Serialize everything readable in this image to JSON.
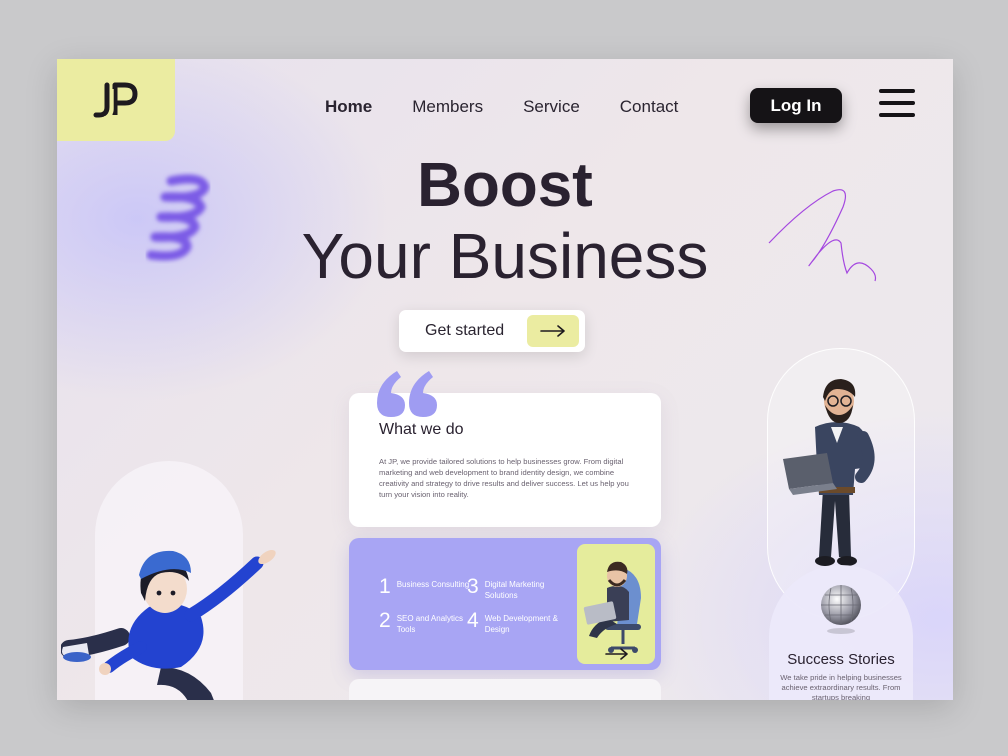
{
  "brand": {
    "logo_text": "JP"
  },
  "nav": {
    "items": [
      {
        "label": "Home",
        "active": true
      },
      {
        "label": "Members",
        "active": false
      },
      {
        "label": "Service",
        "active": false
      },
      {
        "label": "Contact",
        "active": false
      }
    ],
    "login_label": "Log In",
    "menu_icon": "hamburger-icon"
  },
  "hero": {
    "title_line1": "Boost",
    "title_line2": "Your Business",
    "cta_label": "Get started",
    "cta_icon": "arrow-right-icon"
  },
  "what_we_do": {
    "quote_icon": "quote-icon",
    "title": "What we do",
    "body": "At JP, we provide tailored solutions to help businesses grow. From digital marketing and web development to brand identity design, we combine creativity and strategy to drive results and deliver success. Let us help you turn your vision into reality."
  },
  "services": {
    "items": [
      {
        "num": "1",
        "label": "Business Consulting"
      },
      {
        "num": "3",
        "label": "Digital Marketing Solutions"
      },
      {
        "num": "2",
        "label": "SEO and Analytics Tools"
      },
      {
        "num": "4",
        "label": "Web Development & Design"
      }
    ],
    "arrow_icon": "arrow-right-icon"
  },
  "success": {
    "icon": "disco-ball-icon",
    "title": "Success Stories",
    "body": "We take pride in helping businesses achieve extraordinary results. From startups breaking"
  },
  "colors": {
    "accent_yellow": "#ebeca1",
    "accent_purple": "#a8a5f4",
    "dark": "#151316"
  }
}
